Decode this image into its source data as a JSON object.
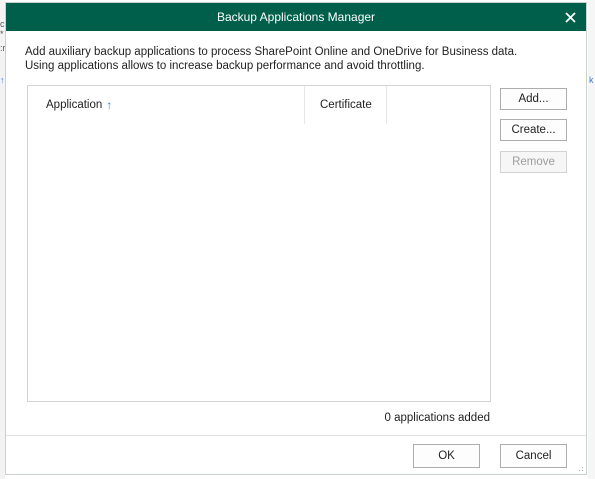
{
  "window": {
    "title": "Backup Applications Manager",
    "close_icon": "close-icon"
  },
  "description": "Add auxiliary backup applications to process SharePoint Online and OneDrive for Business data. Using applications allows to increase backup performance and avoid throttling.",
  "table": {
    "columns": [
      {
        "label": "Application",
        "sort": "ascending",
        "sort_icon": "sort-ascending-icon"
      },
      {
        "label": "Certificate"
      }
    ],
    "rows": []
  },
  "side_buttons": {
    "add": "Add...",
    "create": "Create...",
    "remove": "Remove"
  },
  "status": {
    "count_text": "0 applications added"
  },
  "footer": {
    "ok": "OK",
    "cancel": "Cancel"
  },
  "colors": {
    "titlebar": "#005f4b",
    "sort_arrow": "#2f7ad6"
  }
}
